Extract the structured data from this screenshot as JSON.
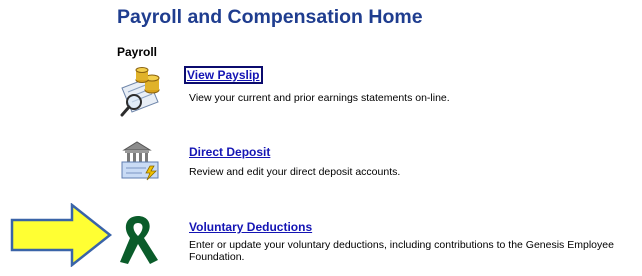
{
  "page": {
    "title": "Payroll and Compensation Home"
  },
  "section": {
    "title": "Payroll"
  },
  "items": [
    {
      "label": "View Payslip",
      "description": "View your current and prior earnings statements on-line.",
      "icon": "payslip-icon"
    },
    {
      "label": "Direct Deposit",
      "description": "Review and edit your direct deposit accounts.",
      "icon": "bank-check-icon"
    },
    {
      "label": "Voluntary Deductions",
      "description": "Enter or update your voluntary deductions, including contributions to the Genesis Employee Foundation.",
      "icon": "green-ribbon-icon"
    }
  ],
  "colors": {
    "title": "#1f3d8f",
    "link": "#1414b4",
    "arrow_fill": "#ffff33",
    "arrow_stroke": "#3a64a8",
    "ribbon": "#0a5c2a"
  }
}
